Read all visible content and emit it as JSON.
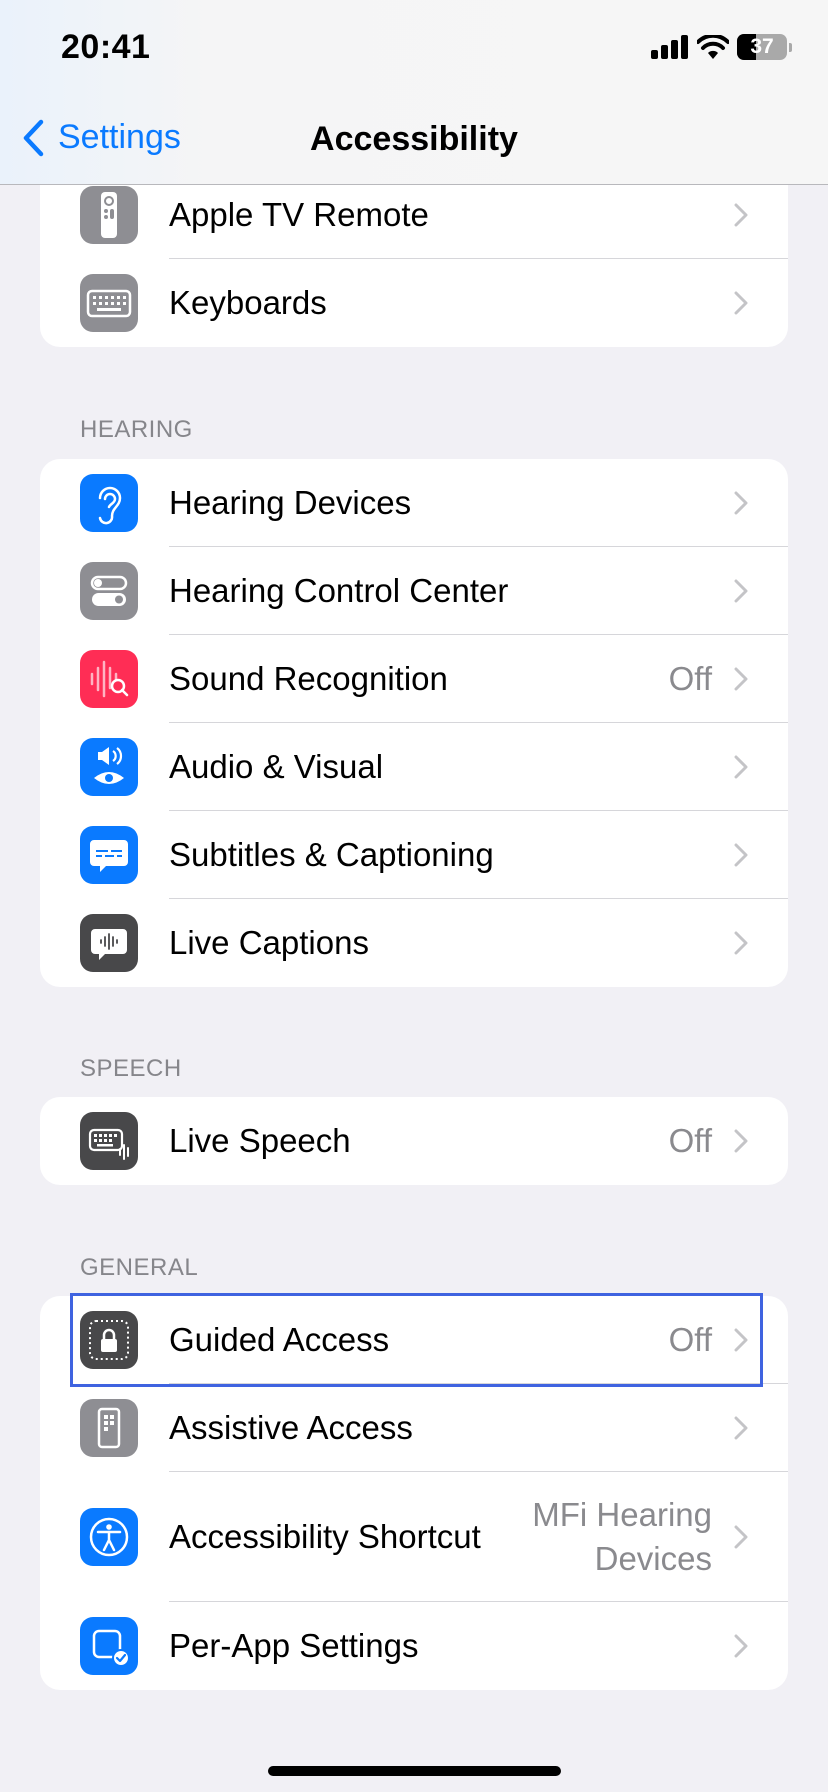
{
  "status_bar": {
    "time": "20:41",
    "battery_level": "37",
    "battery_fraction": 0.37,
    "icons": [
      "cellular-signal-icon",
      "wifi-icon",
      "battery-icon"
    ]
  },
  "nav": {
    "back_label": "Settings",
    "title": "Accessibility"
  },
  "colors": {
    "accent": "#0a7aff",
    "background": "#f1f0f5",
    "highlight_border": "#3f63e0"
  },
  "sections": [
    {
      "header": "",
      "items": [
        {
          "label": "Apple TV Remote",
          "value": "",
          "icon": "apple-tv-remote-icon",
          "icon_color": "#8e8e93"
        },
        {
          "label": "Keyboards",
          "value": "",
          "icon": "keyboard-icon",
          "icon_color": "#8e8e93"
        }
      ]
    },
    {
      "header": "HEARING",
      "items": [
        {
          "label": "Hearing Devices",
          "value": "",
          "icon": "ear-icon",
          "icon_color": "#0a7aff"
        },
        {
          "label": "Hearing Control Center",
          "value": "",
          "icon": "toggles-icon",
          "icon_color": "#8e8e93"
        },
        {
          "label": "Sound Recognition",
          "value": "Off",
          "icon": "sound-recognition-icon",
          "icon_color": "#ff2d55"
        },
        {
          "label": "Audio & Visual",
          "value": "",
          "icon": "speaker-eye-icon",
          "icon_color": "#0a7aff"
        },
        {
          "label": "Subtitles & Captioning",
          "value": "",
          "icon": "subtitles-bubble-icon",
          "icon_color": "#0a7aff"
        },
        {
          "label": "Live Captions",
          "value": "",
          "icon": "live-captions-icon",
          "icon_color": "#48484a"
        }
      ]
    },
    {
      "header": "SPEECH",
      "items": [
        {
          "label": "Live Speech",
          "value": "Off",
          "icon": "keyboard-waveform-icon",
          "icon_color": "#48484a"
        }
      ]
    },
    {
      "header": "GENERAL",
      "items": [
        {
          "label": "Guided Access",
          "value": "Off",
          "icon": "lock-dotted-frame-icon",
          "icon_color": "#48484a"
        },
        {
          "label": "Assistive Access",
          "value": "",
          "icon": "assistive-access-icon",
          "icon_color": "#8e8e93"
        },
        {
          "label": "Accessibility Shortcut",
          "value_line1": "MFi Hearing",
          "value_line2": "Devices",
          "icon": "accessibility-person-icon",
          "icon_color": "#0a7aff"
        },
        {
          "label": "Per-App Settings",
          "value": "",
          "icon": "app-checkmark-icon",
          "icon_color": "#0a7aff"
        }
      ]
    }
  ]
}
